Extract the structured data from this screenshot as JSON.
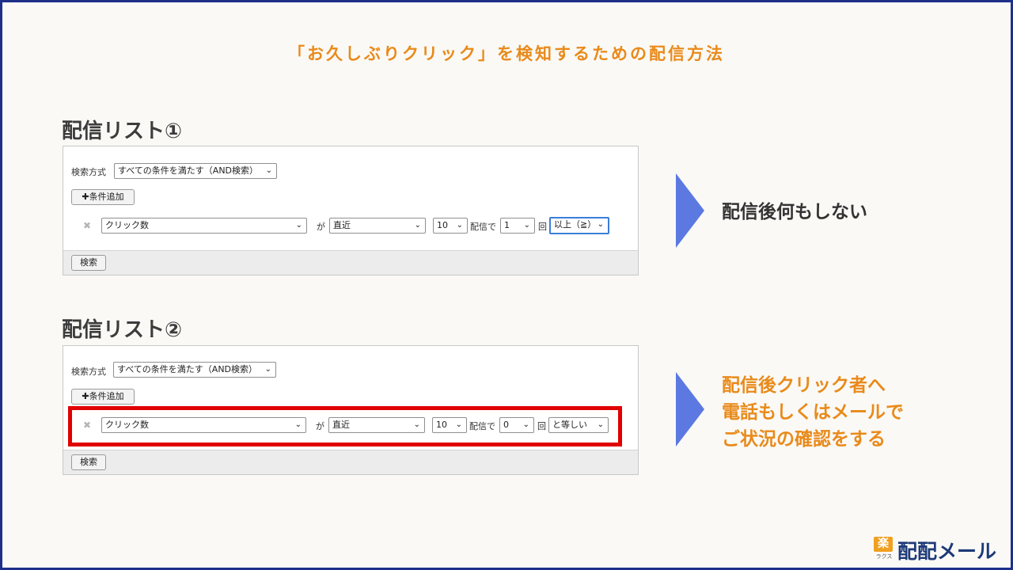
{
  "title": "「お久しぶりクリック」を検知するための配信方法",
  "lists": [
    {
      "heading": "配信リスト①",
      "search_method_label": "検索方式",
      "search_method_value": "すべての条件を満たす（AND検索）",
      "add_condition_label": "✚条件追加",
      "field_value": "クリック数",
      "ga_label": "が",
      "period_value": "直近",
      "count_value": "10",
      "haishin_de_label": "配信で",
      "times_value": "1",
      "kai_label": "回",
      "comparison_value": "以上（≧）",
      "search_button_label": "検索",
      "note": "配信後何もしない"
    },
    {
      "heading": "配信リスト②",
      "search_method_label": "検索方式",
      "search_method_value": "すべての条件を満たす（AND検索）",
      "add_condition_label": "✚条件追加",
      "field_value": "クリック数",
      "ga_label": "が",
      "period_value": "直近",
      "count_value": "10",
      "haishin_de_label": "配信で",
      "times_value": "0",
      "kai_label": "回",
      "comparison_value": "と等しい",
      "search_button_label": "検索",
      "note_lines": [
        "配信後クリック者へ",
        "電話もしくはメールで",
        "ご状況の確認をする"
      ]
    }
  ],
  "logo": {
    "mark": "楽",
    "sub": "ラクス",
    "brand": "配配メール"
  },
  "colors": {
    "accent_orange": "#e98a1a",
    "arrow_blue": "#5b79e0",
    "highlight_red": "#e00000",
    "brand_navy": "#1d3a78"
  }
}
